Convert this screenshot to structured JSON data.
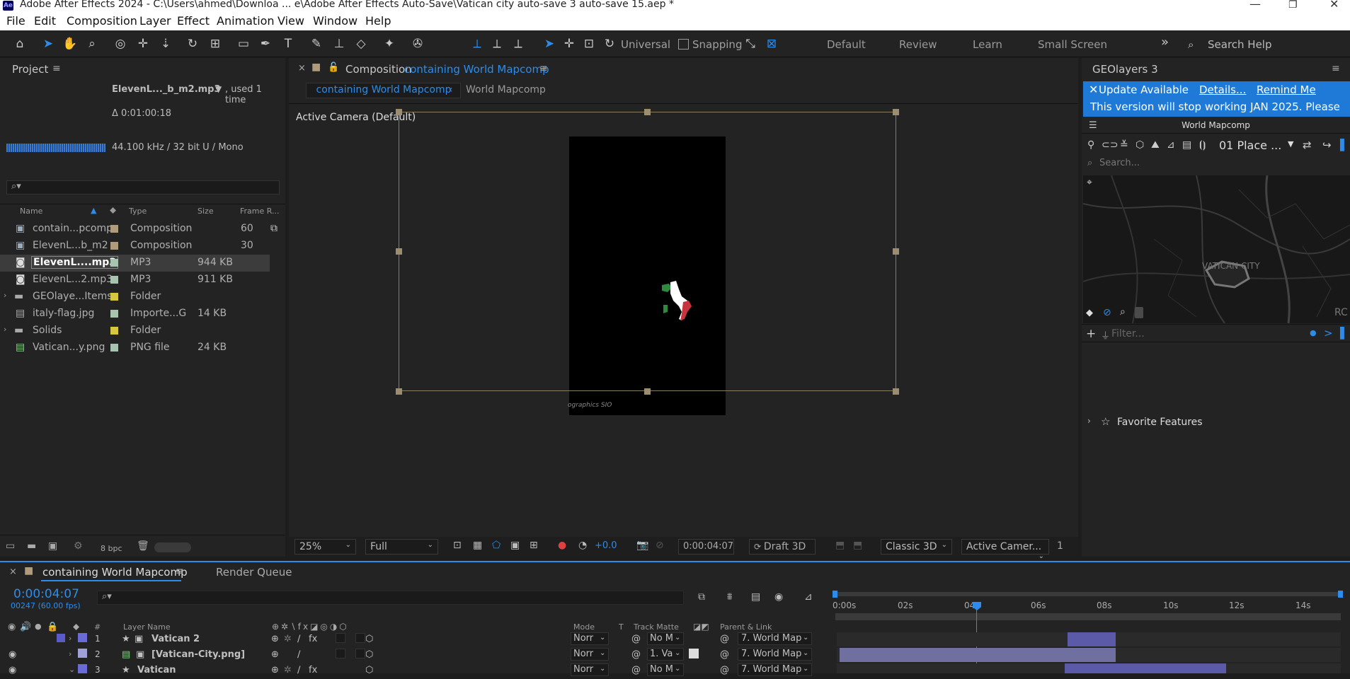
{
  "window": {
    "title": "Adobe After Effects 2024 - C:\\Users\\ahmed\\Downloa ... e\\Adobe After Effects Auto-Save\\Vatican city auto-save 3 auto-save 15.aep *",
    "logo": "Ae",
    "minimize": "—",
    "maximize": "❐",
    "close": "✕"
  },
  "menu": [
    "File",
    "Edit",
    "Composition",
    "Layer",
    "Effect",
    "Animation",
    "View",
    "Window",
    "Help"
  ],
  "toolbar": {
    "universal": "Universal",
    "snapping": "Snapping",
    "workspaces": [
      "Default",
      "Review",
      "Learn",
      "Small Screen"
    ],
    "more": "»",
    "search_placeholder": "Search Help"
  },
  "project": {
    "title": "Project",
    "selected_name": "ElevenL..._b_m2.mp3",
    "used": ", used 1 time",
    "duration": "Δ 0:01:00:18",
    "audio_info": "44.100 kHz / 32 bit U / Mono",
    "columns": [
      "Name",
      "Type",
      "Size",
      "Frame R..."
    ],
    "items": [
      {
        "name": "contain...pcomp",
        "type": "Composition",
        "size": "",
        "rate": "60",
        "color": "#b09c7a"
      },
      {
        "name": "ElevenL...b_m2",
        "type": "Composition",
        "size": "",
        "rate": "30",
        "color": "#b09c7a"
      },
      {
        "name": "ElevenL....mp3",
        "type": "MP3",
        "size": "944 KB",
        "rate": "",
        "color": "#a8c4b0"
      },
      {
        "name": "ElevenL...2.mp3",
        "type": "MP3",
        "size": "911 KB",
        "rate": "",
        "color": "#a8c4b0"
      },
      {
        "name": "GEOlaye...Items",
        "type": "Folder",
        "size": "",
        "rate": "",
        "color": "#d8c640"
      },
      {
        "name": "italy-flag.jpg",
        "type": "Importe...G",
        "size": "14 KB",
        "rate": "",
        "color": "#a8c4b0"
      },
      {
        "name": "Solids",
        "type": "Folder",
        "size": "",
        "rate": "",
        "color": "#d8c640"
      },
      {
        "name": "Vatican...y.png",
        "type": "PNG file",
        "size": "24 KB",
        "rate": "",
        "color": "#a8c4b0"
      }
    ],
    "bpc": "8 bpc"
  },
  "composition": {
    "label": "Composition",
    "name": "containing World Mapcomp",
    "breadcrumb_active": "containing World Mapcomp",
    "breadcrumb_next": "World Mapcomp",
    "camera": "Active Camera (Default)",
    "watermark": "ographics  SIO",
    "zoom": "25%",
    "resolution": "Full",
    "exposure": "+0.0",
    "timecode": "0:00:04:07",
    "draft": "Draft 3D",
    "renderer": "Classic 3D",
    "view": "Active Camer...",
    "views_count": "1"
  },
  "geolayers": {
    "title": "GEOlayers 3",
    "update": "Update Available",
    "details": "Details...",
    "remind": "Remind Me",
    "warning": "This version will stop working JAN 2025. Please",
    "comp_name": "World Mapcomp",
    "place_label": "01 Place ...",
    "search_placeholder": "Search...",
    "map_label": "VATICAN CITY",
    "map_edge_label": "RC",
    "filter_placeholder": "Filter...",
    "favorites": "Favorite Features"
  },
  "timeline": {
    "tab": "containing World Mapcomp",
    "render_queue": "Render Queue",
    "timecode": "0:00:04:07",
    "frames": "00247 (60.00 fps)",
    "columns": {
      "layer_name": "Layer Name",
      "mode": "Mode",
      "t": "T",
      "track_matte": "Track Matte",
      "parent": "Parent & Link",
      "hash": "#"
    },
    "ruler": [
      "0:00s",
      "02s",
      "04s",
      "06s",
      "08s",
      "10s",
      "12s",
      "14s"
    ],
    "layers": [
      {
        "num": "1",
        "name": "Vatican 2",
        "mode": "Norr",
        "matte": "No M",
        "parent": "7. World Map",
        "color": "#6e6ee0",
        "bar_color": "#5a5aa8"
      },
      {
        "num": "2",
        "name": "[Vatican-City.png]",
        "mode": "Norr",
        "matte": "1. Va",
        "parent": "7. World Map",
        "color": "#a0a0d8",
        "bar_color": "#7070a0"
      },
      {
        "num": "3",
        "name": "Vatican",
        "mode": "Norr",
        "matte": "No M",
        "parent": "7. World Map",
        "color": "#6e6ee0",
        "bar_color": "#5a5aa8"
      }
    ]
  }
}
